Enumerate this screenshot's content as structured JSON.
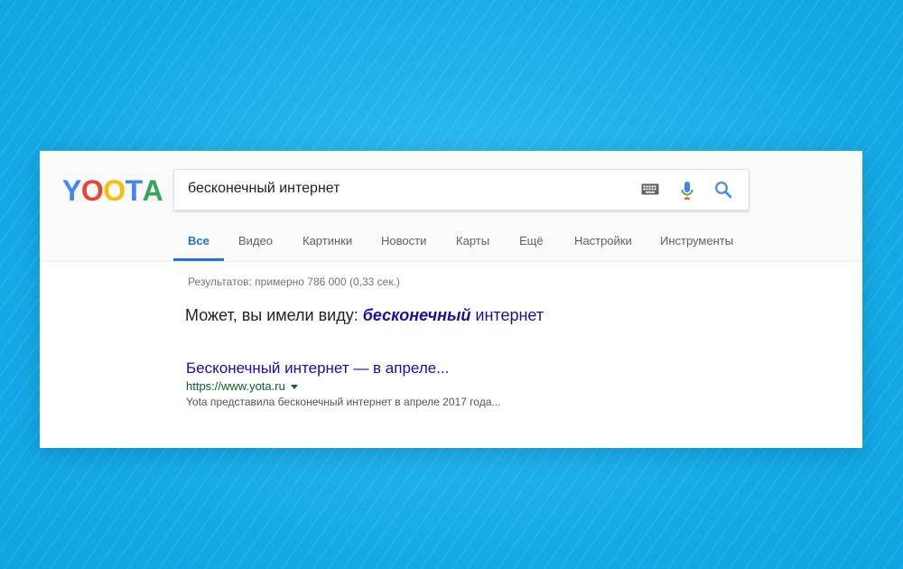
{
  "logo": {
    "letters": [
      {
        "char": "Y",
        "color": "#4285f4"
      },
      {
        "char": "O",
        "color": "#ea4335"
      },
      {
        "char": "O",
        "color": "#fbbc05"
      },
      {
        "char": "T",
        "color": "#4285f4"
      },
      {
        "char": "A",
        "color": "#34a853"
      }
    ]
  },
  "search": {
    "query": "бесконечный интернет",
    "icons": [
      "keyboard-icon",
      "microphone-icon",
      "search-icon"
    ]
  },
  "tabs": [
    {
      "label": "Все",
      "active": true
    },
    {
      "label": "Видео"
    },
    {
      "label": "Картинки"
    },
    {
      "label": "Новости"
    },
    {
      "label": "Карты"
    },
    {
      "label": "Ещё"
    },
    {
      "label": "Настройки"
    },
    {
      "label": "Инструменты"
    }
  ],
  "results_count": "Результатов: примерно 786 000 (0,33 сек.)",
  "did_you_mean": {
    "prefix": "Может, вы имели виду: ",
    "correction": "бесконечный",
    "rest": " интернет"
  },
  "result": {
    "title": "Бесконечный интернет — в апреле...",
    "url": "https://www.yota.ru",
    "snippet": "Yota представила бесконечный интернет в апреле 2017 года..."
  },
  "colors": {
    "background": "#1fb0ea",
    "link": "#1a0dab",
    "url": "#006621",
    "accent": "#1a73e8"
  }
}
